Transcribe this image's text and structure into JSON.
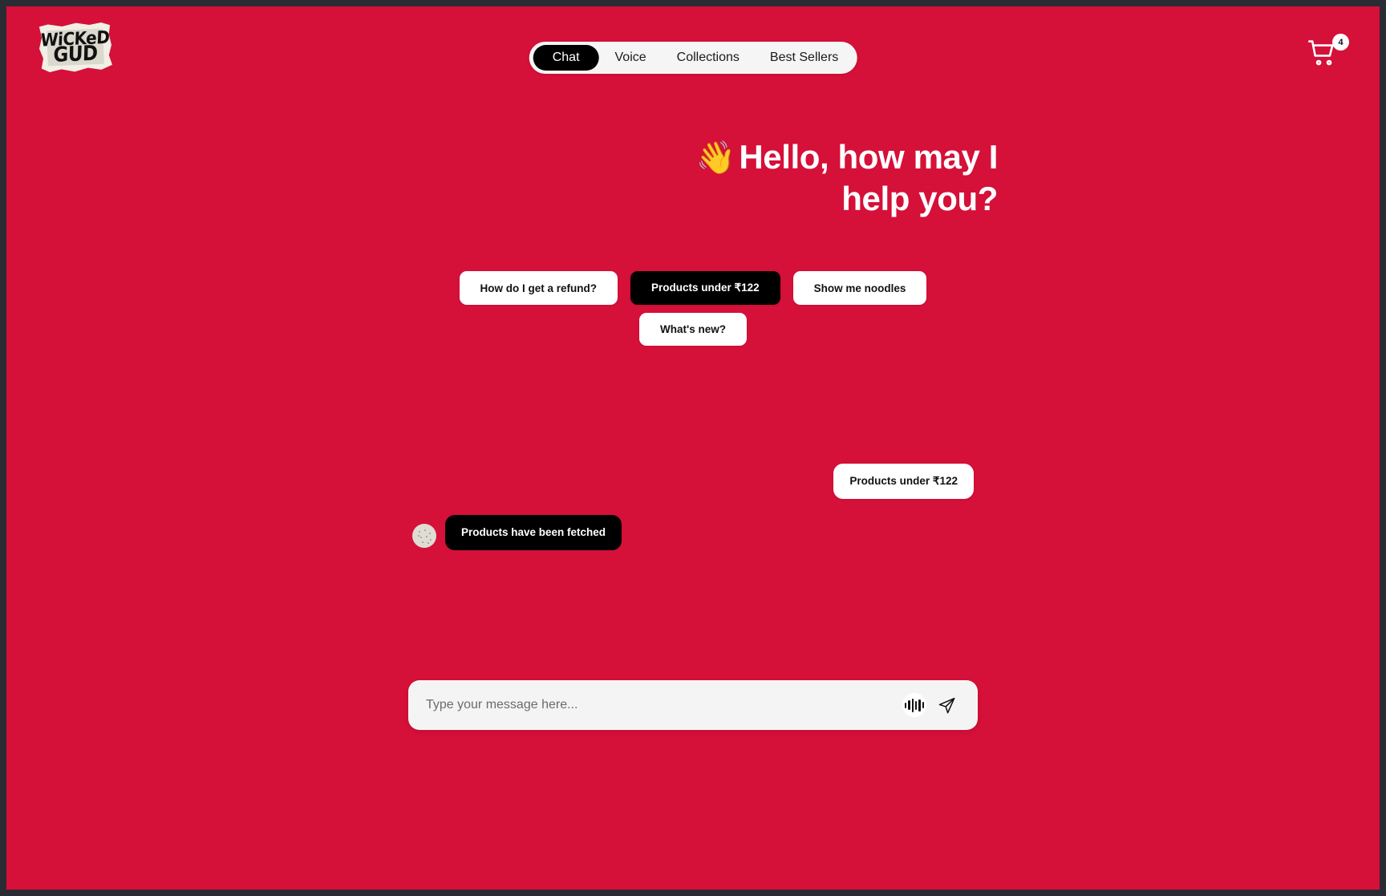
{
  "theme": {
    "background": "#D51039",
    "accent_dark": "#000000",
    "surface_light": "#F5F5F5",
    "text_on_dark": "#FFFFFF"
  },
  "header": {
    "logo": {
      "name": "wickedgud-logo",
      "line1": "WiCKeD",
      "line2": "GUD"
    },
    "nav": {
      "items": [
        {
          "label": "Chat",
          "active": true
        },
        {
          "label": "Voice",
          "active": false
        },
        {
          "label": "Collections",
          "active": false
        },
        {
          "label": "Best Sellers",
          "active": false
        }
      ]
    },
    "cart": {
      "icon": "shopping-cart-icon",
      "badge_count": "4"
    }
  },
  "hero": {
    "wave_emoji": "👋",
    "title_line1": "Hello, how may I",
    "title_line2": "help you?"
  },
  "suggestions": {
    "chips": [
      {
        "label": "How do I get a refund?",
        "selected": false
      },
      {
        "label": "Products under ₹122",
        "selected": true
      },
      {
        "label": "Show me noodles",
        "selected": false
      },
      {
        "label": "What's new?",
        "selected": false
      }
    ]
  },
  "conversation": {
    "messages": [
      {
        "role": "user",
        "text": "Products under ₹122"
      },
      {
        "role": "assistant",
        "text": "Products have been fetched",
        "avatar": "bot-avatar"
      }
    ]
  },
  "composer": {
    "placeholder": "Type your message here...",
    "value": "",
    "voice_icon": "waveform-icon",
    "send_icon": "send-paper-plane-icon"
  }
}
